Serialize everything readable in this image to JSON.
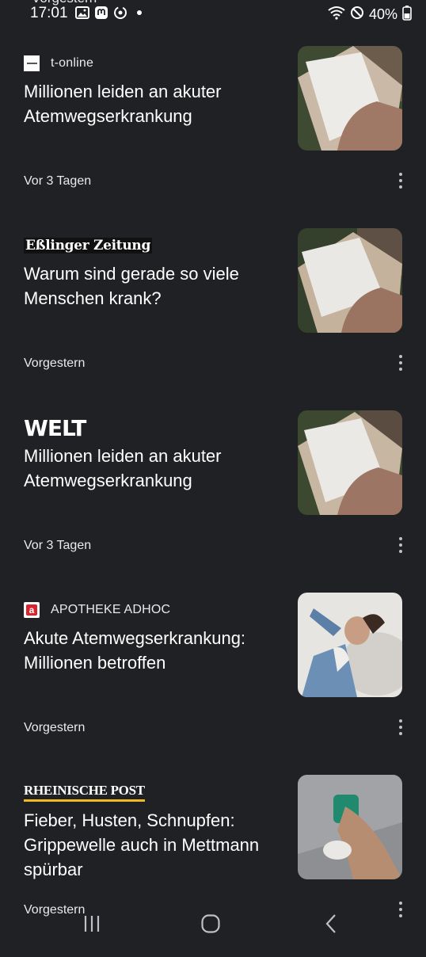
{
  "status_bar": {
    "peek_text": "Vorgestern",
    "time": "17:01",
    "battery": "40%"
  },
  "articles": [
    {
      "source": "t-online",
      "headline": "Millionen leiden an akuter Atemwegserkrankung",
      "time": "Vor 3 Tagen"
    },
    {
      "source": "Eßlinger Zeitung",
      "headline": "Warum sind gerade so viele Menschen krank?",
      "time": "Vorgestern"
    },
    {
      "source": "WELT",
      "headline": "Millionen leiden an akuter Atemwegserkrankung",
      "time": "Vor 3 Tagen"
    },
    {
      "source": "APOTHEKE ADHOC",
      "headline": "Akute Atemwegserkrankung: Millionen betroffen",
      "time": "Vorgestern"
    },
    {
      "source": "RHEINISCHE POST",
      "headline": "Fieber, Husten, Schnupfen: Grippewelle auch in Mettmann spürbar",
      "time": "Vorgestern"
    }
  ],
  "icons": {
    "gallery": "image-icon",
    "mastodon": "mastodon-icon",
    "sync": "sync-icon",
    "wifi": "wifi-icon",
    "dnd": "do-not-disturb-icon",
    "battery": "battery-icon",
    "more": "more-vert-icon",
    "recents": "recents-icon",
    "home": "home-icon",
    "back": "back-icon"
  }
}
